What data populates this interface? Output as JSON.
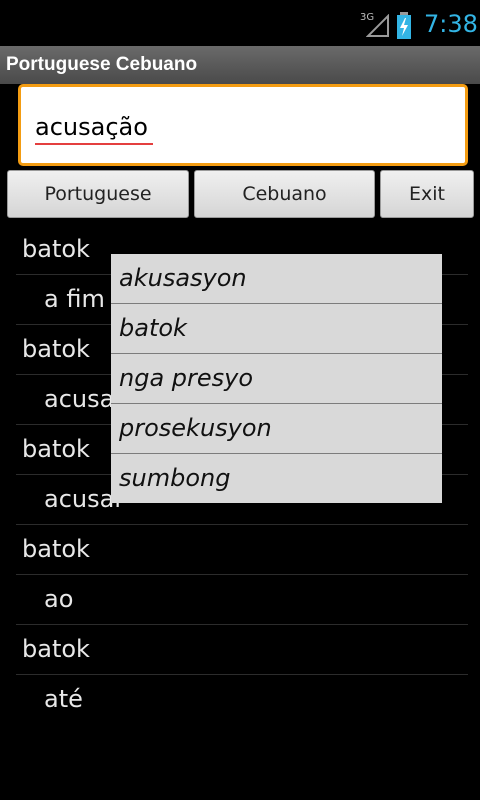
{
  "status_bar": {
    "network": "3G",
    "time": "7:38",
    "accent_color": "#33b5e5"
  },
  "title_bar": {
    "title": "Portuguese Cebuano"
  },
  "search": {
    "value": "acusação"
  },
  "buttons": {
    "portuguese": "Portuguese",
    "cebuano": "Cebuano",
    "exit": "Exit"
  },
  "results": [
    {
      "word": "batok",
      "type": "head"
    },
    {
      "word": "a fim",
      "type": "sub"
    },
    {
      "word": "batok",
      "type": "head"
    },
    {
      "word": "acusa",
      "type": "sub"
    },
    {
      "word": "batok",
      "type": "head"
    },
    {
      "word": "acusar",
      "type": "sub"
    },
    {
      "word": "batok",
      "type": "head"
    },
    {
      "word": "ao",
      "type": "sub"
    },
    {
      "word": "batok",
      "type": "head"
    },
    {
      "word": "até",
      "type": "sub"
    }
  ],
  "popup": {
    "items": [
      "akusasyon",
      "batok",
      "nga presyo",
      "prosekusyon",
      "sumbong"
    ]
  }
}
